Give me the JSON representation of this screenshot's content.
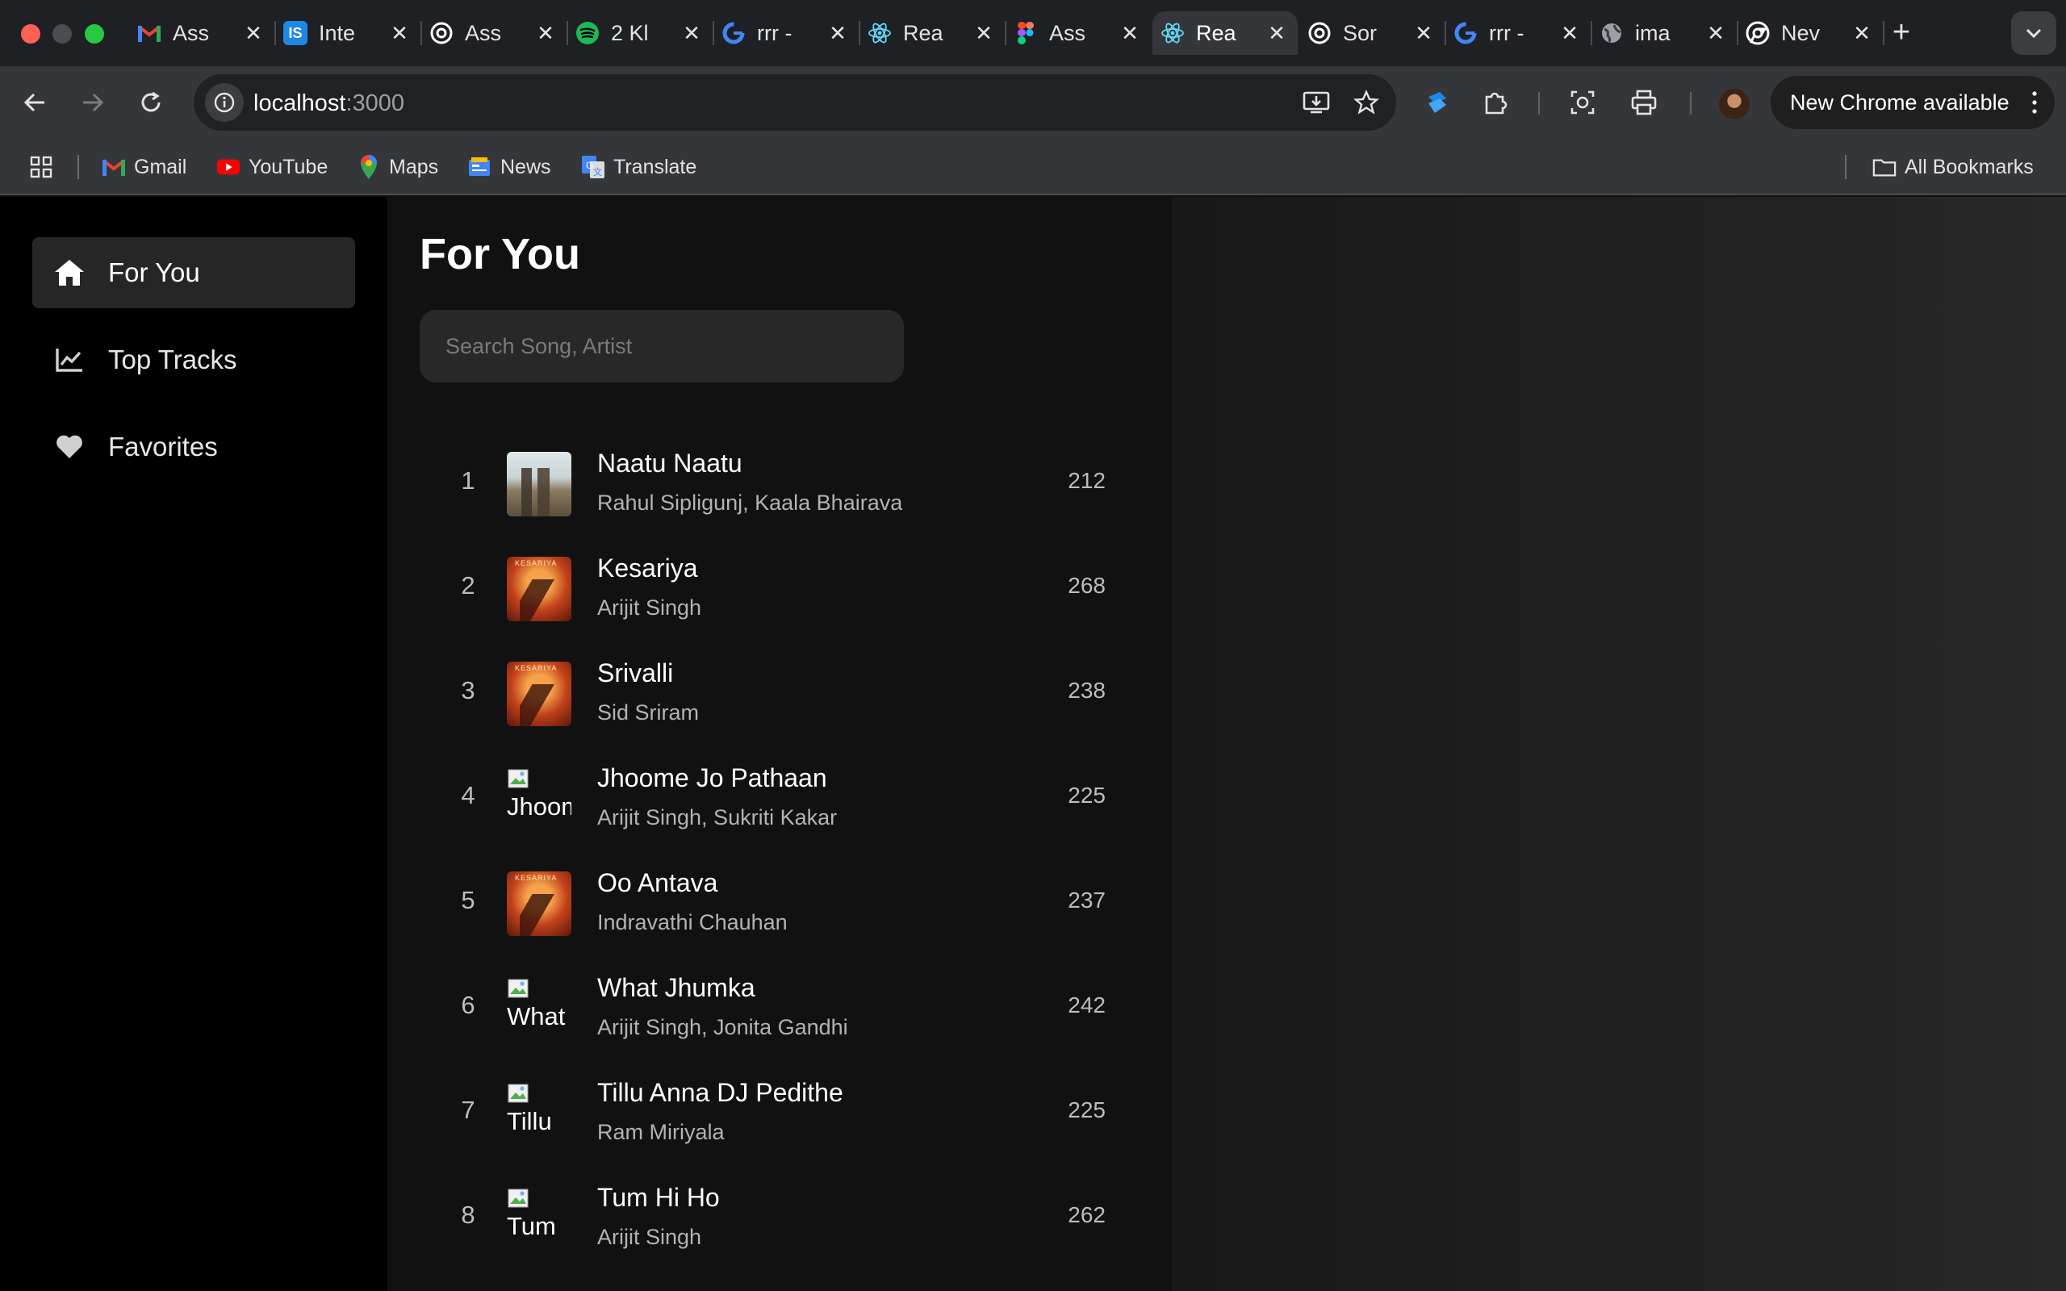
{
  "browser": {
    "tabs": [
      {
        "label": "Ass",
        "icon": "gmail-icon",
        "color": "#ea4335"
      },
      {
        "label": "Inte",
        "icon": "is-icon",
        "color": "#1e88e5"
      },
      {
        "label": "Ass",
        "icon": "openai-icon",
        "color": "#ffffff"
      },
      {
        "label": "2 Kl",
        "icon": "spotify-icon",
        "color": "#1db954"
      },
      {
        "label": "rrr -",
        "icon": "google-icon",
        "color": "#4285f4"
      },
      {
        "label": "Rea",
        "icon": "react-icon",
        "color": "#61dafb"
      },
      {
        "label": "Ass",
        "icon": "figma-icon",
        "color": "#f24e1e"
      },
      {
        "label": "Rea",
        "icon": "react-icon",
        "color": "#61dafb",
        "active": true
      },
      {
        "label": "Sor",
        "icon": "openai-icon",
        "color": "#ffffff"
      },
      {
        "label": "rrr -",
        "icon": "google-icon",
        "color": "#4285f4"
      },
      {
        "label": "ima",
        "icon": "globe-icon",
        "color": "#9aa0a6"
      },
      {
        "label": "Nev",
        "icon": "chrome-icon",
        "color": "#ffffff"
      }
    ],
    "url": {
      "host": "localhost",
      "port": ":3000"
    },
    "update_label": "New Chrome available",
    "bookmarks": [
      {
        "label": "Gmail",
        "icon": "gmail-icon"
      },
      {
        "label": "YouTube",
        "icon": "youtube-icon"
      },
      {
        "label": "Maps",
        "icon": "maps-icon"
      },
      {
        "label": "News",
        "icon": "news-icon"
      },
      {
        "label": "Translate",
        "icon": "translate-icon"
      }
    ],
    "all_bookmarks_label": "All Bookmarks"
  },
  "sidebar": {
    "items": [
      {
        "label": "For You",
        "icon": "home-icon",
        "active": true
      },
      {
        "label": "Top Tracks",
        "icon": "chart-line-icon"
      },
      {
        "label": "Favorites",
        "icon": "heart-icon"
      }
    ]
  },
  "main": {
    "title": "For You",
    "search_placeholder": "Search Song, Artist",
    "tracks": [
      {
        "index": "1",
        "name": "Naatu Naatu",
        "artist": "Rahul Sipligunj, Kaala Bhairava",
        "plays": "212",
        "cover": "naatu"
      },
      {
        "index": "2",
        "name": "Kesariya",
        "artist": "Arijit Singh",
        "plays": "268",
        "cover": "kesariya"
      },
      {
        "index": "3",
        "name": "Srivalli",
        "artist": "Sid Sriram",
        "plays": "238",
        "cover": "kesariya"
      },
      {
        "index": "4",
        "name": "Jhoome Jo Pathaan",
        "artist": "Arijit Singh, Sukriti Kakar",
        "plays": "225",
        "cover": "broken",
        "alt": "Jhoome"
      },
      {
        "index": "5",
        "name": "Oo Antava",
        "artist": "Indravathi Chauhan",
        "plays": "237",
        "cover": "kesariya"
      },
      {
        "index": "6",
        "name": "What Jhumka",
        "artist": "Arijit Singh, Jonita Gandhi",
        "plays": "242",
        "cover": "broken",
        "alt": "What"
      },
      {
        "index": "7",
        "name": "Tillu Anna DJ Pedithe",
        "artist": "Ram Miriyala",
        "plays": "225",
        "cover": "broken",
        "alt": "Tillu"
      },
      {
        "index": "8",
        "name": "Tum Hi Ho",
        "artist": "Arijit Singh",
        "plays": "262",
        "cover": "broken",
        "alt": "Tum"
      }
    ]
  }
}
